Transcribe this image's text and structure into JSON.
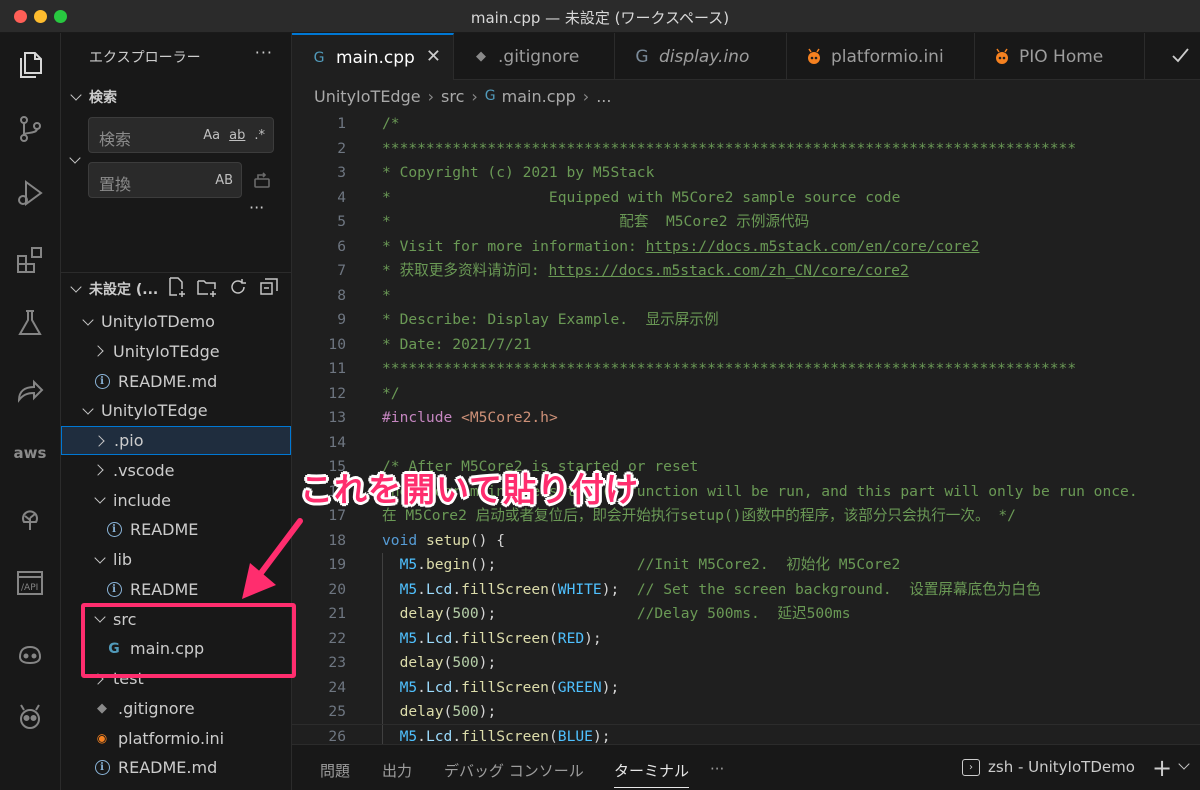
{
  "window": {
    "title": "main.cpp — 未設定 (ワークスペース)"
  },
  "sidebar": {
    "title": "エクスプローラー",
    "more": "···",
    "search_section": "検索",
    "search_placeholder": "検索",
    "search_opts": [
      "Aa",
      "ab",
      ".*"
    ],
    "replace_placeholder": "置換",
    "replace_opt": "AB",
    "replace_more": "···",
    "workspace_label": "未設定 (...",
    "tree": [
      {
        "label": "UnityIoTDemo",
        "indent": 1,
        "kind": "folder-open"
      },
      {
        "label": "UnityIoTEdge",
        "indent": 2,
        "kind": "folder-closed"
      },
      {
        "label": "README.md",
        "indent": 2,
        "kind": "info"
      },
      {
        "label": "UnityIoTEdge",
        "indent": 1,
        "kind": "folder-open"
      },
      {
        "label": ".pio",
        "indent": 2,
        "kind": "folder-closed",
        "selected": true
      },
      {
        "label": ".vscode",
        "indent": 2,
        "kind": "folder-closed"
      },
      {
        "label": "include",
        "indent": 2,
        "kind": "folder-open"
      },
      {
        "label": "README",
        "indent": 3,
        "kind": "info"
      },
      {
        "label": "lib",
        "indent": 2,
        "kind": "folder-open"
      },
      {
        "label": "README",
        "indent": 3,
        "kind": "info"
      },
      {
        "label": "src",
        "indent": 2,
        "kind": "folder-open"
      },
      {
        "label": "main.cpp",
        "indent": 3,
        "kind": "cpp"
      },
      {
        "label": "test",
        "indent": 2,
        "kind": "folder-closed"
      },
      {
        "label": ".gitignore",
        "indent": 2,
        "kind": "git"
      },
      {
        "label": "platformio.ini",
        "indent": 2,
        "kind": "pio"
      },
      {
        "label": "README.md",
        "indent": 2,
        "kind": "info"
      }
    ]
  },
  "tabs": [
    {
      "label": "main.cpp",
      "icon": "cpp",
      "active": true
    },
    {
      "label": ".gitignore",
      "icon": "git"
    },
    {
      "label": "display.ino",
      "icon": "cpp-dim",
      "italic": true
    },
    {
      "label": "platformio.ini",
      "icon": "pio"
    },
    {
      "label": "PIO Home",
      "icon": "pio"
    }
  ],
  "breadcrumb": [
    "UnityIoTEdge",
    "src",
    "main.cpp",
    "..."
  ],
  "code_lines": [
    [
      [
        "cm",
        "/*"
      ]
    ],
    [
      [
        "cm",
        "*******************************************************************************"
      ]
    ],
    [
      [
        "cm",
        "* Copyright (c) 2021 by M5Stack"
      ]
    ],
    [
      [
        "cm",
        "*                  Equipped with M5Core2 sample source code"
      ]
    ],
    [
      [
        "cm",
        "*                          配套  M5Core2 示例源代码"
      ]
    ],
    [
      [
        "cm",
        "* Visit for more information: "
      ],
      [
        "cm link",
        "https://docs.m5stack.com/en/core/core2"
      ]
    ],
    [
      [
        "cm",
        "* 获取更多资料请访问: "
      ],
      [
        "cm link",
        "https://docs.m5stack.com/zh_CN/core/core2"
      ]
    ],
    [
      [
        "cm",
        "*"
      ]
    ],
    [
      [
        "cm",
        "* Describe: Display Example.  显示屏示例"
      ]
    ],
    [
      [
        "cm",
        "* Date: 2021/7/21"
      ]
    ],
    [
      [
        "cm",
        "*******************************************************************************"
      ]
    ],
    [
      [
        "cm",
        "*/"
      ]
    ],
    [
      [
        "pp",
        "#include "
      ],
      [
        "str",
        "<M5Core2.h>"
      ]
    ],
    [],
    [
      [
        "cm",
        "/* After M5Core2 is started or reset"
      ]
    ],
    [
      [
        "cm",
        "the program in the setUp () function will be run, and this part will only be run once."
      ]
    ],
    [
      [
        "cm",
        "在 M5Core2 启动或者复位后，即会开始执行setup()函数中的程序，该部分只会执行一次。 */"
      ]
    ],
    [
      [
        "kw",
        "void "
      ],
      [
        "fn",
        "setup"
      ],
      [
        "pl",
        "() {"
      ]
    ],
    [
      [
        "pl",
        "  "
      ],
      [
        "cn",
        "M5"
      ],
      [
        "pl",
        "."
      ],
      [
        "fn",
        "begin"
      ],
      [
        "pl",
        "();                "
      ],
      [
        "cm",
        "//Init M5Core2.  初始化 M5Core2"
      ]
    ],
    [
      [
        "pl",
        "  "
      ],
      [
        "cn",
        "M5"
      ],
      [
        "pl",
        "."
      ],
      [
        "id",
        "Lcd"
      ],
      [
        "pl",
        "."
      ],
      [
        "fn",
        "fillScreen"
      ],
      [
        "pl",
        "("
      ],
      [
        "cn",
        "WHITE"
      ],
      [
        "pl",
        ");  "
      ],
      [
        "cm",
        "// Set the screen background.  设置屏幕底色为白色"
      ]
    ],
    [
      [
        "pl",
        "  "
      ],
      [
        "fn",
        "delay"
      ],
      [
        "pl",
        "("
      ],
      [
        "num",
        "500"
      ],
      [
        "pl",
        ");                "
      ],
      [
        "cm",
        "//Delay 500ms.  延迟500ms"
      ]
    ],
    [
      [
        "pl",
        "  "
      ],
      [
        "cn",
        "M5"
      ],
      [
        "pl",
        "."
      ],
      [
        "id",
        "Lcd"
      ],
      [
        "pl",
        "."
      ],
      [
        "fn",
        "fillScreen"
      ],
      [
        "pl",
        "("
      ],
      [
        "cn",
        "RED"
      ],
      [
        "pl",
        ");"
      ]
    ],
    [
      [
        "pl",
        "  "
      ],
      [
        "fn",
        "delay"
      ],
      [
        "pl",
        "("
      ],
      [
        "num",
        "500"
      ],
      [
        "pl",
        ");"
      ]
    ],
    [
      [
        "pl",
        "  "
      ],
      [
        "cn",
        "M5"
      ],
      [
        "pl",
        "."
      ],
      [
        "id",
        "Lcd"
      ],
      [
        "pl",
        "."
      ],
      [
        "fn",
        "fillScreen"
      ],
      [
        "pl",
        "("
      ],
      [
        "cn",
        "GREEN"
      ],
      [
        "pl",
        ");"
      ]
    ],
    [
      [
        "pl",
        "  "
      ],
      [
        "fn",
        "delay"
      ],
      [
        "pl",
        "("
      ],
      [
        "num",
        "500"
      ],
      [
        "pl",
        ");"
      ]
    ],
    [
      [
        "pl",
        "  "
      ],
      [
        "cn",
        "M5"
      ],
      [
        "pl",
        "."
      ],
      [
        "id",
        "Lcd"
      ],
      [
        "pl",
        "."
      ],
      [
        "fn",
        "fillScreen"
      ],
      [
        "pl",
        "("
      ],
      [
        "cn",
        "BLUE"
      ],
      [
        "pl",
        ");"
      ]
    ]
  ],
  "panel": {
    "tabs": [
      "問題",
      "出力",
      "デバッグ コンソール",
      "ターミナル"
    ],
    "active_tab": "ターミナル",
    "more": "···",
    "terminal_name": "zsh - UnityIoTDemo",
    "plus": "+"
  },
  "annotation": {
    "text": "これを開いて貼り付け",
    "color": "#ff2d6e"
  }
}
